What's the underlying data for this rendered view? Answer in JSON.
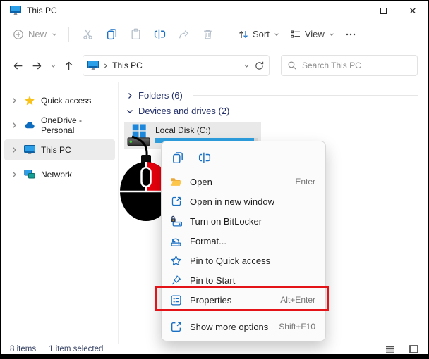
{
  "titlebar": {
    "title": "This PC"
  },
  "toolbar": {
    "new": "New",
    "sort": "Sort",
    "view": "View",
    "icons": [
      "plus-circle-icon",
      "cut-icon",
      "copy-icon",
      "paste-icon",
      "rename-icon",
      "share-icon",
      "delete-icon",
      "sort-arrows-icon",
      "view-list-icon",
      "more-ellipsis-icon"
    ]
  },
  "navbar": {
    "location": "This PC",
    "search_placeholder": "Search This PC",
    "icons": [
      "back-arrow-icon",
      "forward-arrow-icon",
      "recent-chevron-icon",
      "up-arrow-icon",
      "monitor-icon",
      "refresh-icon",
      "search-icon"
    ]
  },
  "sidebar": {
    "items": [
      {
        "label": "Quick access",
        "icon": "star-icon"
      },
      {
        "label": "OneDrive - Personal",
        "icon": "cloud-icon"
      },
      {
        "label": "This PC",
        "icon": "monitor-icon",
        "selected": true
      },
      {
        "label": "Network",
        "icon": "network-icon"
      }
    ]
  },
  "content": {
    "group_folders": "Folders (6)",
    "group_devices": "Devices and drives (2)",
    "drive_name": "Local Disk (C:)",
    "drive_icon": "windows-drive-icon"
  },
  "context_menu": {
    "quick_icons": [
      "copy-icon",
      "rename-icon"
    ],
    "items": [
      {
        "label": "Open",
        "shortcut": "Enter",
        "icon": "folder-open-icon"
      },
      {
        "label": "Open in new window",
        "shortcut": "",
        "icon": "open-new-window-icon"
      },
      {
        "label": "Turn on BitLocker",
        "shortcut": "",
        "icon": "bitlocker-lock-icon"
      },
      {
        "label": "Format...",
        "shortcut": "",
        "icon": "format-drive-icon"
      },
      {
        "label": "Pin to Quick access",
        "shortcut": "",
        "icon": "star-outline-icon"
      },
      {
        "label": "Pin to Start",
        "shortcut": "",
        "icon": "pin-icon"
      },
      {
        "label": "Properties",
        "shortcut": "Alt+Enter",
        "icon": "properties-icon",
        "highlighted": true
      },
      {
        "label": "Show more options",
        "shortcut": "Shift+F10",
        "icon": "show-more-icon"
      }
    ]
  },
  "statusbar": {
    "items": "8 items",
    "selection": "1 item selected"
  },
  "colors": {
    "accent_blue": "#1b70c4",
    "disabled_gray": "#b4bfca",
    "header_navy": "#24316b",
    "usage_bar_blue": "#2e9fdf",
    "annotation_red": "#e31317",
    "selection_gray": "#e9e9e9"
  }
}
